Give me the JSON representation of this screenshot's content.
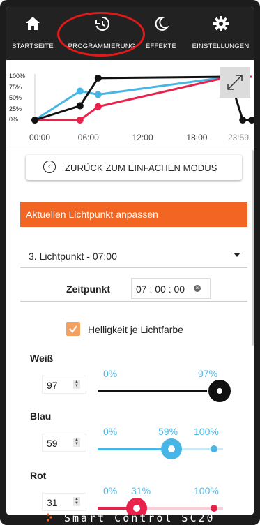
{
  "nav": {
    "items": [
      {
        "label": "STARTSEITE",
        "icon": "home-icon"
      },
      {
        "label": "PROGRAMMIERUNG",
        "icon": "history-icon"
      },
      {
        "label": "EFFEKTE",
        "icon": "moon-icon"
      },
      {
        "label": "EINSTELLUNGEN",
        "icon": "gear-icon"
      }
    ],
    "highlight_color": "#e01a1a"
  },
  "chart_data": {
    "type": "line",
    "x_ticks": [
      "00:00",
      "06:00",
      "12:00",
      "18:00",
      "23:59"
    ],
    "y_ticks": [
      "100%",
      "75%",
      "50%",
      "25%",
      "0%"
    ],
    "ylim": [
      0,
      100
    ],
    "series": [
      {
        "color": "#47b5e5",
        "points": [
          [
            "00:00",
            0
          ],
          [
            "05:00",
            67
          ],
          [
            "07:00",
            59
          ],
          [
            "21:30",
            100
          ],
          [
            "23:59",
            100
          ]
        ]
      },
      {
        "color": "#e8224a",
        "points": [
          [
            "00:00",
            0
          ],
          [
            "05:00",
            0
          ],
          [
            "07:00",
            31
          ],
          [
            "21:30",
            100
          ],
          [
            "23:59",
            100
          ]
        ]
      },
      {
        "color": "#111111",
        "points": [
          [
            "00:00",
            0
          ],
          [
            "05:00",
            33
          ],
          [
            "07:00",
            97
          ],
          [
            "21:30",
            100
          ],
          [
            "23:00",
            0
          ],
          [
            "23:59",
            0
          ]
        ]
      }
    ],
    "legend": "none",
    "grid": false
  },
  "main": {
    "back_button_label": "ZURÜCK ZUM EINFACHEN MODUS",
    "section_title": "Aktuellen Lichtpunkt anpassen",
    "section_color": "#f26522",
    "selected_point": "3. Lichtpunkt - 07:00",
    "time_label": "Zeitpunkt",
    "time_value": "07 : 00 : 00",
    "checkbox_label": "Helligkeit je Lichtfarbe",
    "checkbox_checked": true
  },
  "channels": [
    {
      "name": "Weiß",
      "value": "97",
      "min_label": "0%",
      "current_label": "97%",
      "max_label": "",
      "level": 97,
      "color": "#111111"
    },
    {
      "name": "Blau",
      "value": "59",
      "min_label": "0%",
      "current_label": "59%",
      "max_label": "100%",
      "level": 59,
      "color": "#47b5e5"
    },
    {
      "name": "Rot",
      "value": "31",
      "min_label": "0%",
      "current_label": "31%",
      "max_label": "100%",
      "level": 31,
      "color": "#e8224a"
    }
  ],
  "footer": {
    "brand": "Smart Control SC20",
    "accent": "#f26522"
  }
}
